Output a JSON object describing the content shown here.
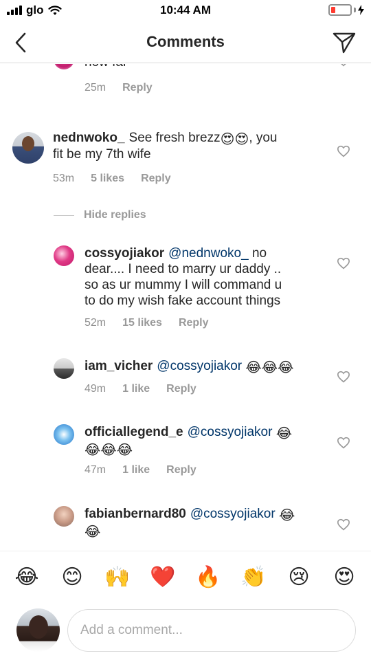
{
  "status_bar": {
    "carrier": "glo",
    "time": "10:44 AM"
  },
  "header": {
    "title": "Comments"
  },
  "comments": [
    {
      "id": "partial-top",
      "text": "how far",
      "time": "25m",
      "reply": "Reply"
    },
    {
      "id": "nednwoko",
      "username": "nednwoko_",
      "text_part1": "See fresh brezz",
      "text_part2": ", you",
      "text_line2": "fit be my 7th wife",
      "time": "53m",
      "likes": "5 likes",
      "reply": "Reply"
    },
    {
      "id": "cossyojiakor",
      "username": "cossyojiakor",
      "mention": "@nednwoko_",
      "text_line1_rest": "no",
      "text_line2": "dear.... I need to marry ur daddy ..",
      "text_line3": "so as ur mummy I will command u",
      "text_line4": "to do my wish fake account things",
      "time": "52m",
      "likes": "15 likes",
      "reply": "Reply"
    },
    {
      "id": "iam_vicher",
      "username": "iam_vicher",
      "mention": "@cossyojiakor",
      "time": "49m",
      "likes": "1 like",
      "reply": "Reply"
    },
    {
      "id": "officiallegend_e",
      "username": "officiallegend_e",
      "mention": "@cossyojiakor",
      "time": "47m",
      "likes": "1 like",
      "reply": "Reply"
    },
    {
      "id": "fabianbernard80",
      "username": "fabianbernard80",
      "mention": "@cossyojiakor"
    }
  ],
  "hide_replies": "Hide replies",
  "reactions": [
    "😂",
    "😊",
    "🙌",
    "❤️",
    "🔥",
    "👏",
    "😢",
    "😍"
  ],
  "emoji": {
    "heart_eyes": "😍",
    "tears_of_joy": "😂"
  },
  "composer": {
    "placeholder": "Add a comment..."
  },
  "colors": {
    "mention": "#003569",
    "meta_grey": "#999999",
    "divider": "#dbdbdb"
  }
}
